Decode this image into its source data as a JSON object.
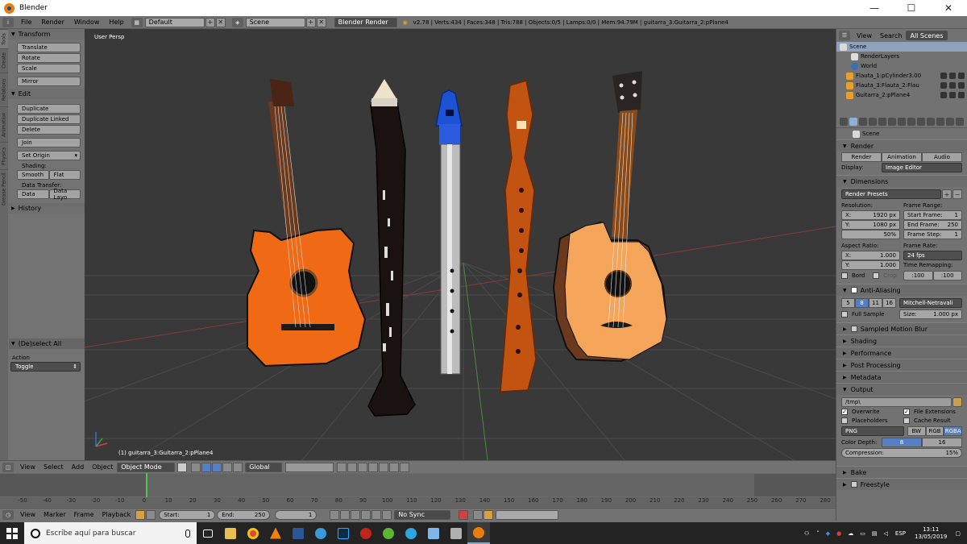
{
  "window": {
    "title": "Blender"
  },
  "info_header": {
    "menus": [
      "File",
      "Render",
      "Window",
      "Help"
    ],
    "layout": "Default",
    "scene": "Scene",
    "engine": "Blender Render",
    "stats": "v2.78 | Verts:434 | Faces:348 | Tris:788 | Objects:0/5 | Lamps:0/0 | Mem:94.79M | guitarra_3:Guitarra_2:pPlane4"
  },
  "tool_shelf": {
    "tabs": [
      "Tools",
      "Create",
      "Relations",
      "Animation",
      "Physics",
      "Grease Pencil"
    ],
    "transform_header": "Transform",
    "transform_buttons": [
      "Translate",
      "Rotate",
      "Scale",
      "Mirror"
    ],
    "edit_header": "Edit",
    "edit_buttons": [
      "Duplicate",
      "Duplicate Linked",
      "Delete",
      "Join"
    ],
    "set_origin": "Set Origin",
    "shading_label": "Shading:",
    "shading_buttons": [
      "Smooth",
      "Flat"
    ],
    "data_transfer_label": "Data Transfer:",
    "data_transfer_buttons": [
      "Data",
      "Data Layo"
    ],
    "history_header": "History",
    "operator_header": "(De)select All",
    "action_label": "Action",
    "action_value": "Toggle"
  },
  "viewport": {
    "view_name": "User Persp",
    "status": "(1) guitarra_3:Guitarra_2:pPlane4"
  },
  "view3d_header": {
    "menus": [
      "View",
      "Select",
      "Add",
      "Object"
    ],
    "mode": "Object Mode",
    "orientation": "Global"
  },
  "timeline": {
    "ticks": [
      "-50",
      "-40",
      "-30",
      "-20",
      "-10",
      "0",
      "10",
      "20",
      "30",
      "40",
      "50",
      "60",
      "70",
      "80",
      "90",
      "100",
      "110",
      "120",
      "130",
      "140",
      "150",
      "160",
      "170",
      "180",
      "190",
      "200",
      "210",
      "220",
      "230",
      "240",
      "250",
      "260",
      "270",
      "280"
    ],
    "menus": [
      "View",
      "Marker",
      "Frame",
      "Playback"
    ],
    "start_label": "Start:",
    "start_value": "1",
    "end_label": "End:",
    "end_value": "250",
    "current_frame": "1",
    "sync": "No Sync"
  },
  "outliner": {
    "tabs": [
      "View",
      "Search",
      "All Scenes"
    ],
    "items": [
      "Scene",
      "RenderLayers",
      "World",
      "Flauta_1:pCylinder3.00",
      "Flauta_3:Flauta_2:Flau",
      "Guitarra_2:pPlane4"
    ]
  },
  "properties": {
    "scene_name": "Scene",
    "render_header": "Render",
    "render_buttons": [
      "Render",
      "Animation",
      "Audio"
    ],
    "display_label": "Display:",
    "display_value": "Image Editor",
    "dimensions_header": "Dimensions",
    "render_presets": "Render Presets",
    "resolution_label": "Resolution:",
    "res_x_label": "X:",
    "res_x": "1920 px",
    "res_y_label": "Y:",
    "res_y": "1080 px",
    "res_pct": "50%",
    "frame_range_label": "Frame Range:",
    "start_frame_label": "Start Frame:",
    "start_frame": "1",
    "end_frame_label": "End Frame:",
    "end_frame": "250",
    "frame_step_label": "Frame Step:",
    "frame_step": "1",
    "aspect_label": "Aspect Ratio:",
    "aspect_x_label": "X:",
    "aspect_x": "1.000",
    "aspect_y_label": "Y:",
    "aspect_y": "1.000",
    "frame_rate_label": "Frame Rate:",
    "frame_rate": "24 fps",
    "time_remap_label": "Time Remapping:",
    "remap_old": ":100",
    "remap_new": ":100",
    "bord_label": "Bord",
    "crop_label": "Crop",
    "aa_header": "Anti-Aliasing",
    "aa_samples": [
      "5",
      "8",
      "11",
      "16"
    ],
    "aa_filter": "Mitchell-Netravali",
    "full_sample": "Full Sample",
    "size_label": "Size:",
    "size_value": "1.000 px",
    "collapsed_panels": [
      "Sampled Motion Blur",
      "Shading",
      "Performance",
      "Post Processing",
      "Metadata"
    ],
    "output_header": "Output",
    "output_path": "/tmp\\",
    "overwrite": "Overwrite",
    "file_extensions": "File Extensions",
    "placeholders": "Placeholders",
    "cache_result": "Cache Result",
    "format": "PNG",
    "color_modes": [
      "BW",
      "RGB",
      "RGBA"
    ],
    "color_depth_label": "Color Depth:",
    "color_depths": [
      "8",
      "16"
    ],
    "compression_label": "Compression:",
    "compression_value": "15%",
    "bottom_panels": [
      "Bake",
      "Freestyle"
    ]
  },
  "taskbar": {
    "search_placeholder": "Escribe aquí para buscar",
    "lang": "ESP",
    "time": "13:11",
    "date": "13/05/2019"
  }
}
